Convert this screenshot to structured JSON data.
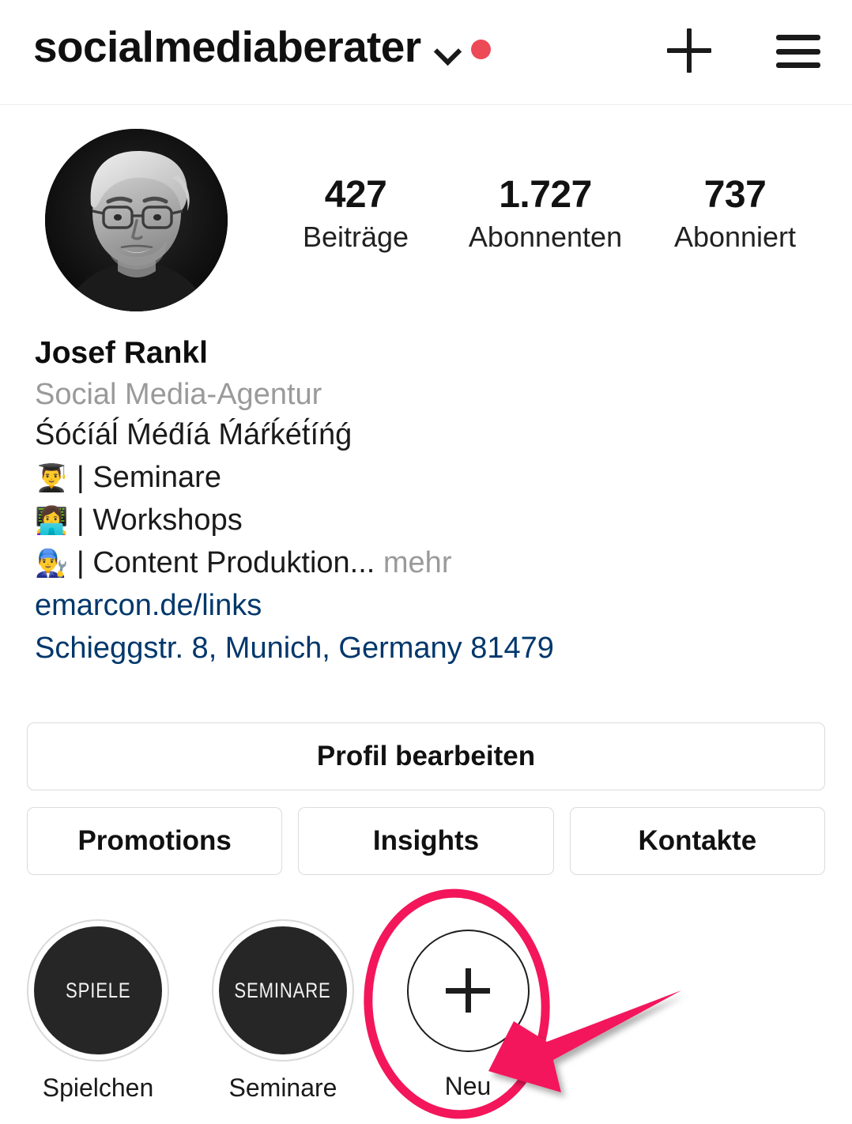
{
  "header": {
    "username": "socialmediaberater",
    "chevron_icon": "chevron-down-icon",
    "badge_icon": "red-dot-badge",
    "badge_color": "#ED4956",
    "add_icon": "plus-icon",
    "menu_icon": "hamburger-menu-icon"
  },
  "profile": {
    "avatar_alt": "Josef Rankl profile photo",
    "stats": [
      {
        "value": "427",
        "label": "Beiträge"
      },
      {
        "value": "1.727",
        "label": "Abonnenten"
      },
      {
        "value": "737",
        "label": "Abonniert"
      }
    ],
    "full_name": "Josef Rankl",
    "category": "Social Media-Agentur",
    "bio_headline": "Śóćíáĺ Ḿéd́íá Ḿáŕḱét́íńǵ",
    "bio_lines": [
      {
        "emoji": "👨‍🎓",
        "text": "| Seminare"
      },
      {
        "emoji": "👩‍💻",
        "text": "| Workshops"
      },
      {
        "emoji": "👨‍🔧",
        "text": "| Content Produktion..."
      }
    ],
    "more_label": "mehr",
    "link": "emarcon.de/links",
    "address": "Schieggstr. 8, Munich, Germany 81479",
    "link_color": "#00376B"
  },
  "actions": {
    "edit_profile": "Profil bearbeiten",
    "promotions": "Promotions",
    "insights": "Insights",
    "contacts": "Kontakte"
  },
  "highlights": [
    {
      "cover_text": "SPIELE",
      "label": "Spielchen"
    },
    {
      "cover_text": "SEMINARE",
      "label": "Seminare"
    }
  ],
  "new_highlight": {
    "label": "Neu",
    "icon": "plus-icon"
  },
  "annotation": {
    "shape": "ellipse-and-arrow",
    "color": "#F3165B",
    "target": "Neu"
  }
}
